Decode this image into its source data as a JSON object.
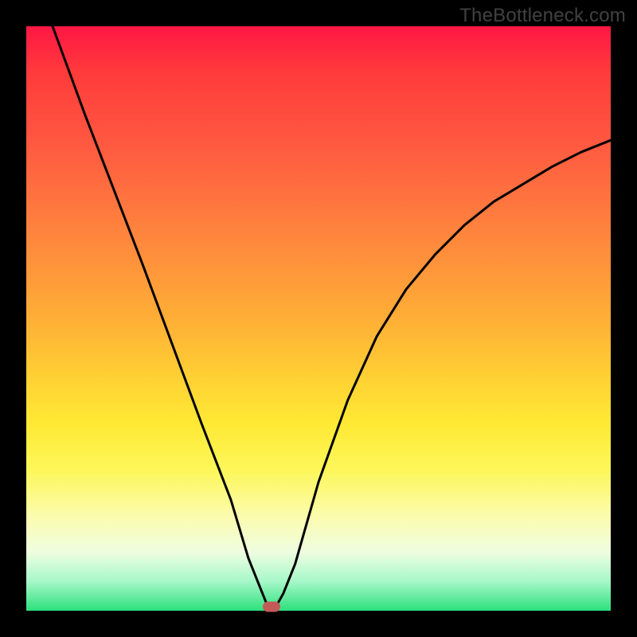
{
  "watermark": "TheBottleneck.com",
  "chart_data": {
    "type": "line",
    "title": "",
    "xlabel": "",
    "ylabel": "",
    "xlim": [
      0,
      100
    ],
    "ylim": [
      0,
      100
    ],
    "grid": false,
    "legend": false,
    "series": [
      {
        "name": "curve",
        "x": [
          4.5,
          10,
          20,
          30,
          35,
          38,
          40,
          41,
          42,
          43,
          44,
          46,
          50,
          55,
          60,
          65,
          70,
          75,
          80,
          85,
          90,
          95,
          100
        ],
        "y": [
          100,
          85,
          59,
          32,
          19,
          9,
          4,
          1.5,
          0.7,
          1.2,
          3,
          8,
          22,
          36,
          47,
          55,
          61,
          66,
          70,
          73,
          76,
          78.5,
          80.5
        ]
      }
    ],
    "marker": {
      "x": 42,
      "y": 0.7,
      "shape": "rounded-rect",
      "color": "#c35a57"
    },
    "background_gradient": {
      "direction": "vertical",
      "stops": [
        {
          "pos": 0.0,
          "color": "#ff1744"
        },
        {
          "pos": 0.5,
          "color": "#ffae36"
        },
        {
          "pos": 0.75,
          "color": "#fdf75a"
        },
        {
          "pos": 1.0,
          "color": "#2be07d"
        }
      ]
    }
  }
}
